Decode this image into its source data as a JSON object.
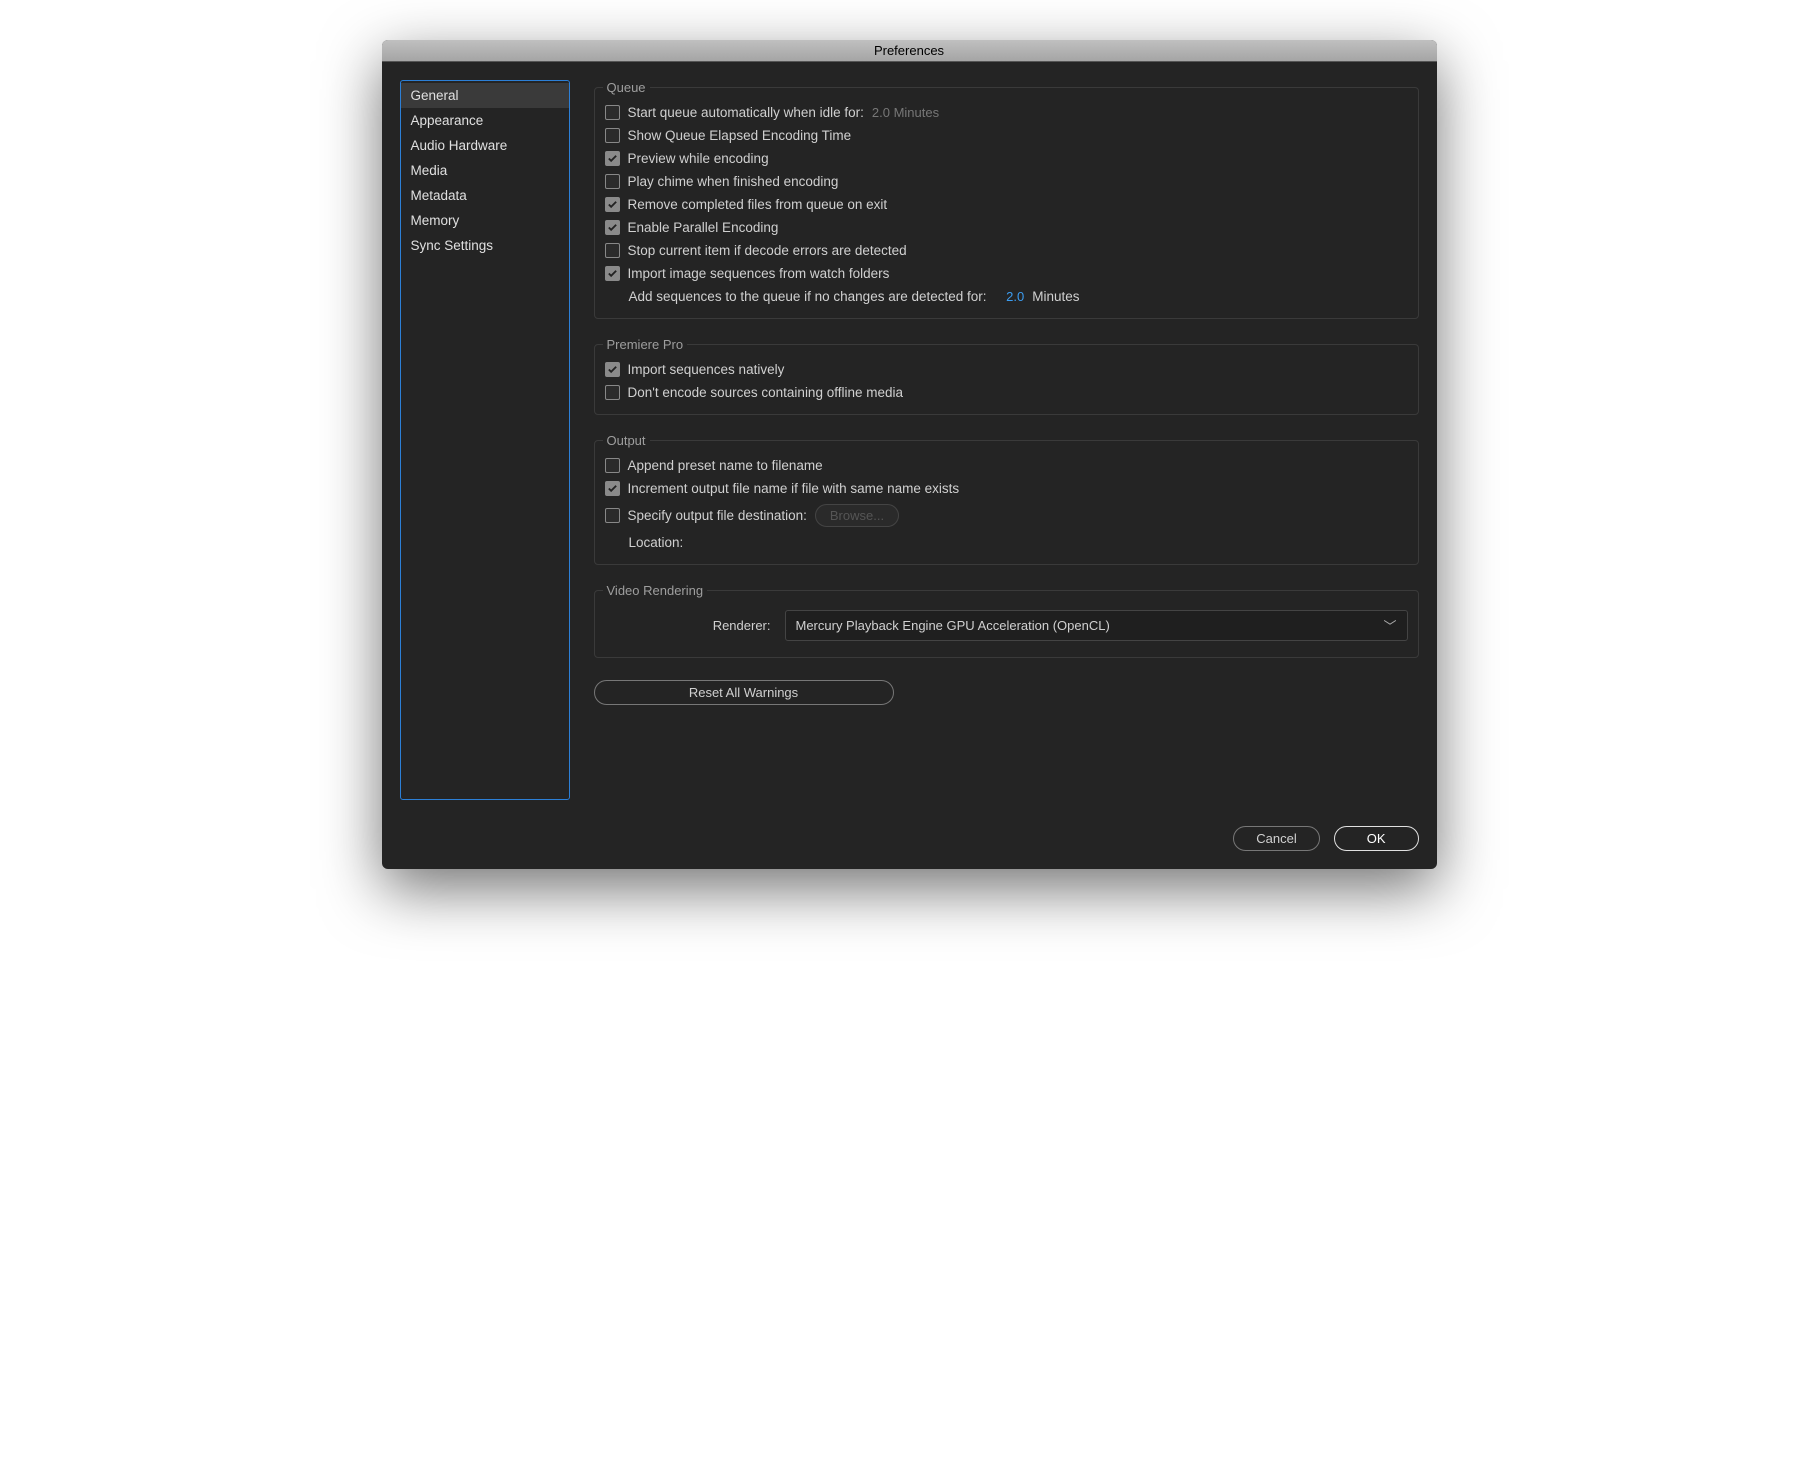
{
  "title": "Preferences",
  "sidebar": {
    "items": [
      {
        "label": "General",
        "selected": true
      },
      {
        "label": "Appearance"
      },
      {
        "label": "Audio Hardware"
      },
      {
        "label": "Media"
      },
      {
        "label": "Metadata"
      },
      {
        "label": "Memory"
      },
      {
        "label": "Sync Settings"
      }
    ]
  },
  "groups": {
    "queue": {
      "legend": "Queue",
      "start_auto_label": "Start queue automatically when idle for:",
      "start_auto_value": "2.0 Minutes",
      "show_elapsed": "Show Queue Elapsed Encoding Time",
      "preview": "Preview while encoding",
      "chime": "Play chime when finished encoding",
      "remove_completed": "Remove completed files from queue on exit",
      "parallel": "Enable Parallel Encoding",
      "stop_on_decode": "Stop current item if decode errors are detected",
      "import_from_watch": "Import image sequences from watch folders",
      "add_seq_label": "Add sequences to the queue if no changes are detected for:",
      "add_seq_value": "2.0",
      "add_seq_unit": "Minutes"
    },
    "premiere": {
      "legend": "Premiere Pro",
      "import_native": "Import sequences natively",
      "dont_encode_offline": "Don't encode sources containing offline media"
    },
    "output": {
      "legend": "Output",
      "append_preset": "Append preset name to filename",
      "increment": "Increment output file name if file with same name exists",
      "specify_dest": "Specify output file destination:",
      "browse": "Browse...",
      "location_label": "Location:",
      "location_value": ""
    },
    "video": {
      "legend": "Video Rendering",
      "renderer_label": "Renderer:",
      "renderer_value": "Mercury Playback Engine GPU Acceleration (OpenCL)"
    }
  },
  "buttons": {
    "reset_warnings": "Reset All Warnings",
    "cancel": "Cancel",
    "ok": "OK"
  }
}
